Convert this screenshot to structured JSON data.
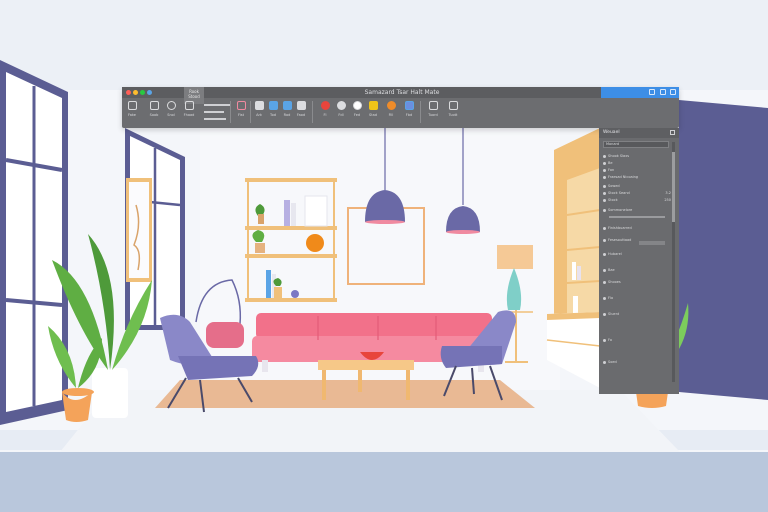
{
  "window": {
    "title": "Samazard Tsar Halt Mate",
    "ribbon_tab_label": "Rook Stood"
  },
  "toolbar": {
    "tools": [
      {
        "name": "select-tool-icon",
        "label": "Fake"
      },
      {
        "name": "move-tool-icon",
        "label": "Soob"
      },
      {
        "name": "scale-tool-icon",
        "label": "Snol"
      },
      {
        "name": "draw-tool-icon",
        "label": "Fhaad"
      },
      {
        "name": "path-tool-icon",
        "label": "Fist"
      },
      {
        "name": "brush-tool-icon",
        "label": "Ark"
      },
      {
        "name": "grid-tool-icon",
        "label": "Tod"
      },
      {
        "name": "image-tool-icon",
        "label": "Rod"
      },
      {
        "name": "photo-tool-icon",
        "label": "Faod"
      },
      {
        "name": "frame-tool-icon",
        "label": "Fatt"
      },
      {
        "name": "record-tool-icon",
        "label": "Fl"
      },
      {
        "name": "clock-tool-icon",
        "label": "Fdl"
      },
      {
        "name": "circle-tool-icon",
        "label": "Fed"
      },
      {
        "name": "shape-tool-icon",
        "label": "Stad"
      },
      {
        "name": "fill-tool-icon",
        "label": "Fill"
      },
      {
        "name": "color-tool-icon",
        "label": "Fbd"
      },
      {
        "name": "layers-tool-icon",
        "label": "Tuord"
      },
      {
        "name": "export-tool-icon",
        "label": "Tuott"
      }
    ]
  },
  "panel": {
    "title": "Weuael",
    "search_value": "Monard",
    "rows": [
      {
        "label": "Shook Slaxs",
        "value": ""
      },
      {
        "label": "Be",
        "value": ""
      },
      {
        "label": "Fon",
        "value": ""
      },
      {
        "label": "Fraesad Nicoaing",
        "value": ""
      },
      {
        "label": "Sowed",
        "value": ""
      },
      {
        "label": "Stock Seand",
        "value": "3.2"
      },
      {
        "label": "Stock",
        "value": "250"
      },
      {
        "label": "Sommonelore",
        "value": ""
      },
      {
        "label": "Finishbuarred",
        "value": ""
      },
      {
        "label": "Fesesouttaad",
        "value": ""
      },
      {
        "label": "Hubarel",
        "value": ""
      },
      {
        "label": "Bae",
        "value": ""
      },
      {
        "label": "Shooes",
        "value": ""
      },
      {
        "label": "Flo",
        "value": ""
      },
      {
        "label": "Sluent",
        "value": ""
      },
      {
        "label": "Fo",
        "value": ""
      },
      {
        "label": "Soed",
        "value": ""
      }
    ]
  },
  "colors": {
    "sofa": "#f2718a",
    "chair": "#8a88c8",
    "lamp": "#6a69a6",
    "wood": "#f0c07a",
    "accent": "#3d8ee6",
    "wall_panel": "#5b5d93"
  }
}
